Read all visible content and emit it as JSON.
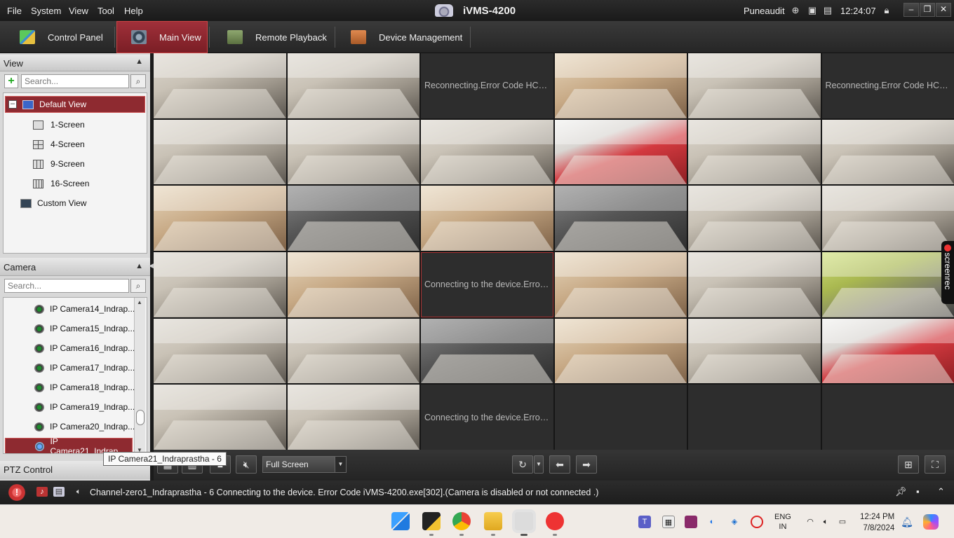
{
  "menubar": {
    "items": [
      "File",
      "System",
      "View",
      "Tool",
      "Help"
    ],
    "app_title": "iVMS-4200",
    "user": "Puneaudit",
    "time": "12:24:07",
    "window_controls": [
      "minimize",
      "restore",
      "close"
    ]
  },
  "tabs": [
    {
      "label": "Control Panel",
      "icon": "control-panel-icon",
      "color": "#4caf50"
    },
    {
      "label": "Main View",
      "icon": "main-view-icon",
      "color": "#3a4a8a",
      "active": true
    },
    {
      "label": "Remote Playback",
      "icon": "remote-playback-icon",
      "color": "#6a8a5a"
    },
    {
      "label": "Device Management",
      "icon": "device-management-icon",
      "color": "#c86a3a"
    }
  ],
  "view_panel": {
    "title": "View",
    "search_placeholder": "Search...",
    "items": [
      {
        "label": "Default View",
        "selected": true
      },
      {
        "label": "1-Screen"
      },
      {
        "label": "4-Screen"
      },
      {
        "label": "9-Screen"
      },
      {
        "label": "16-Screen"
      },
      {
        "label": "Custom View"
      }
    ]
  },
  "camera_panel": {
    "title": "Camera",
    "search_placeholder": "Search...",
    "items": [
      {
        "label": "IP Camera14_Indrap..."
      },
      {
        "label": "IP Camera15_Indrap..."
      },
      {
        "label": "IP Camera16_Indrap..."
      },
      {
        "label": "IP Camera17_Indrap..."
      },
      {
        "label": "IP Camera18_Indrap..."
      },
      {
        "label": "IP Camera19_Indrap..."
      },
      {
        "label": "IP Camera20_Indrap..."
      },
      {
        "label": "IP Camera21_Indrap...",
        "selected": true
      }
    ],
    "scroll_fraction": 0.85
  },
  "tooltip": "IP Camera21_Indraprastha - 6",
  "ptz_title": "PTZ Control",
  "grid": {
    "rows": 6,
    "cols": 6,
    "tiles": [
      {
        "kind": "cam",
        "tone": "light"
      },
      {
        "kind": "cam",
        "tone": "light"
      },
      {
        "kind": "msg",
        "text": "Reconnecting.Error Code HCN..."
      },
      {
        "kind": "cam",
        "tone": "warm"
      },
      {
        "kind": "cam",
        "tone": "light"
      },
      {
        "kind": "msg",
        "text": "Reconnecting.Error Code HCN..."
      },
      {
        "kind": "cam",
        "tone": "light"
      },
      {
        "kind": "cam",
        "tone": "light"
      },
      {
        "kind": "cam",
        "tone": "light"
      },
      {
        "kind": "cam",
        "tone": "red"
      },
      {
        "kind": "cam",
        "tone": "light"
      },
      {
        "kind": "cam",
        "tone": "light"
      },
      {
        "kind": "cam",
        "tone": "warm"
      },
      {
        "kind": "cam",
        "tone": "dark"
      },
      {
        "kind": "cam",
        "tone": "warm"
      },
      {
        "kind": "cam",
        "tone": "dark"
      },
      {
        "kind": "cam",
        "tone": "light"
      },
      {
        "kind": "cam",
        "tone": "light"
      },
      {
        "kind": "cam",
        "tone": "light"
      },
      {
        "kind": "cam",
        "tone": "warm"
      },
      {
        "kind": "msg",
        "text": "Connecting to the device.Error ...",
        "selected": true
      },
      {
        "kind": "cam",
        "tone": "warm"
      },
      {
        "kind": "cam",
        "tone": "light"
      },
      {
        "kind": "cam",
        "tone": "green"
      },
      {
        "kind": "cam",
        "tone": "light"
      },
      {
        "kind": "cam",
        "tone": "light"
      },
      {
        "kind": "cam",
        "tone": "dark"
      },
      {
        "kind": "cam",
        "tone": "warm"
      },
      {
        "kind": "cam",
        "tone": "light"
      },
      {
        "kind": "cam",
        "tone": "red"
      },
      {
        "kind": "cam",
        "tone": "light"
      },
      {
        "kind": "cam",
        "tone": "light"
      },
      {
        "kind": "msg",
        "text": "Connecting to the device.Error ..."
      },
      {
        "kind": "empty"
      },
      {
        "kind": "empty"
      },
      {
        "kind": "empty"
      }
    ]
  },
  "screenrec_label": "screenrec",
  "toolbar": {
    "screen_mode": "Full Screen"
  },
  "status": {
    "message": "Channel-zero1_Indraprastha - 6 Connecting to the device. Error Code iVMS-4200.exe[302].(Camera is disabled or not connected .)"
  },
  "taskbar": {
    "lang_line1": "ENG",
    "lang_line2": "IN",
    "time": "12:24 PM",
    "date": "7/8/2024"
  },
  "colors": {
    "accent_red": "#8e2a30",
    "tile_empty": "#2d2d2d"
  }
}
